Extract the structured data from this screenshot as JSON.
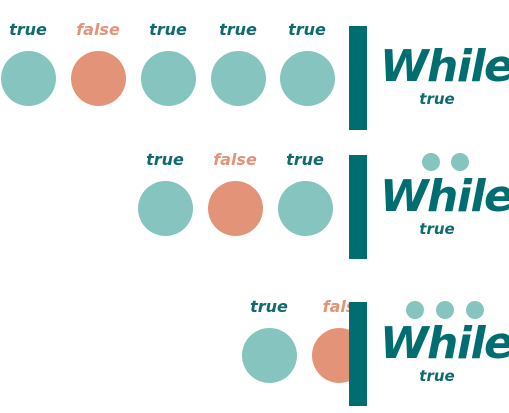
{
  "keyword": "While",
  "colors": {
    "true": "#86c5bf",
    "false": "#e39478",
    "accent": "#006d70",
    "text_true": "#0f6b6e"
  },
  "rows": [
    {
      "labels": [
        "true",
        "false",
        "true",
        "true",
        "true"
      ],
      "keyword": "While",
      "condition": "true",
      "waiting_dots": 0
    },
    {
      "labels": [
        "true",
        "false",
        "true"
      ],
      "keyword": "While",
      "condition": "true",
      "waiting_dots": 2
    },
    {
      "labels": [
        "true",
        "fals"
      ],
      "keyword": "While",
      "condition": "true",
      "waiting_dots": 3
    }
  ]
}
